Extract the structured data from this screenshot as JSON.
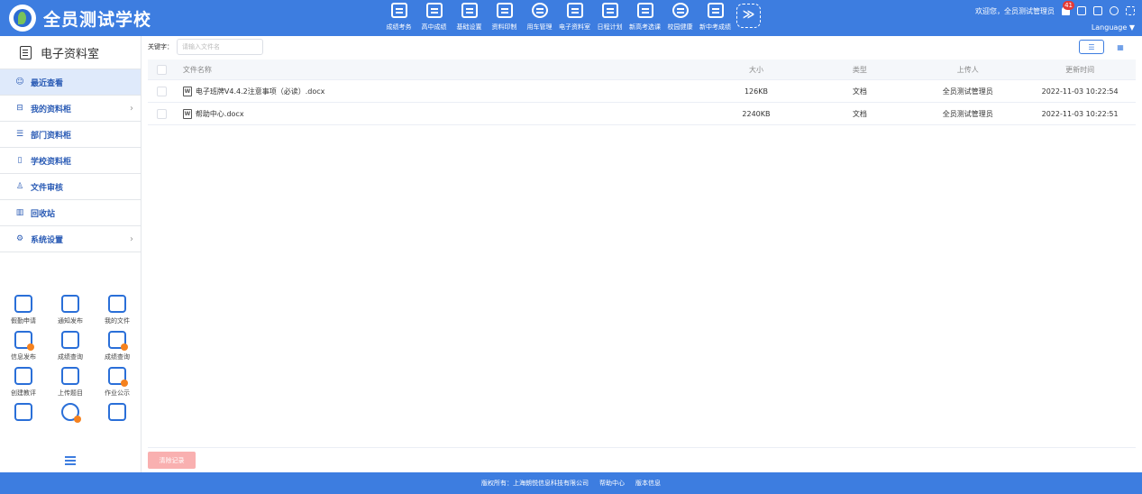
{
  "brand": {
    "name": "全员测试学校"
  },
  "topnav": [
    {
      "label": "成绩考务",
      "icon": "report-card-icon"
    },
    {
      "label": "高中成绩",
      "icon": "report-card-icon"
    },
    {
      "label": "基础设置",
      "icon": "layers-icon"
    },
    {
      "label": "资料印制",
      "icon": "printer-icon"
    },
    {
      "label": "用车管理",
      "icon": "car-icon"
    },
    {
      "label": "电子资料室",
      "icon": "document-icon"
    },
    {
      "label": "日程计划",
      "icon": "calendar-list-icon"
    },
    {
      "label": "新高考选课",
      "icon": "chair-icon"
    },
    {
      "label": "校园健康",
      "icon": "heart-pulse-icon"
    },
    {
      "label": "新中考成绩",
      "icon": "report-card-icon"
    }
  ],
  "more_icon": "double-chevron-down-icon",
  "user": {
    "welcome": "欢迎您，全员测试管理员",
    "badge_count": "41",
    "language": "Language ▼"
  },
  "sidebar": {
    "title": "电子资料室",
    "items": [
      {
        "label": "最近查看",
        "icon": "☺",
        "active": true,
        "chevron": ""
      },
      {
        "label": "我的资料柜",
        "icon": "⊟",
        "active": false,
        "chevron": "›"
      },
      {
        "label": "部门资料柜",
        "icon": "☰",
        "active": false,
        "chevron": ""
      },
      {
        "label": "学校资料柜",
        "icon": "▯",
        "active": false,
        "chevron": ""
      },
      {
        "label": "文件审核",
        "icon": "♙",
        "active": false,
        "chevron": ""
      },
      {
        "label": "回收站",
        "icon": "▥",
        "active": false,
        "chevron": ""
      },
      {
        "label": "系统设置",
        "icon": "⚙",
        "active": false,
        "chevron": "›"
      }
    ],
    "quick_links": [
      {
        "label": "假勤申请",
        "icon": "leave-request-icon"
      },
      {
        "label": "通知发布",
        "icon": "megaphone-icon"
      },
      {
        "label": "我的文件",
        "icon": "folder-icon"
      },
      {
        "label": "信息发布",
        "icon": "info-publish-icon"
      },
      {
        "label": "成绩查询",
        "icon": "score-query-icon"
      },
      {
        "label": "成绩查询",
        "icon": "score-100-icon"
      },
      {
        "label": "创建教评",
        "icon": "chat-bubble-icon"
      },
      {
        "label": "上传题目",
        "icon": "upload-question-icon"
      },
      {
        "label": "作业公示",
        "icon": "homework-icon"
      },
      {
        "label": "",
        "icon": "id-card-icon"
      },
      {
        "label": "",
        "icon": "user-settings-icon"
      },
      {
        "label": "",
        "icon": "building-icon"
      }
    ]
  },
  "search": {
    "label": "关键字：",
    "placeholder": "请输入文件名"
  },
  "view_toggle": {
    "list": "☰",
    "grid": "▦"
  },
  "table": {
    "headers": {
      "name": "文件名称",
      "size": "大小",
      "type": "类型",
      "uploader": "上传人",
      "updated": "更新时间"
    },
    "rows": [
      {
        "name": "电子班牌V4.4.2注意事项（必读）.docx",
        "size": "126KB",
        "type": "文档",
        "uploader": "全员测试管理员",
        "updated": "2022-11-03 10:22:54"
      },
      {
        "name": "帮助中心.docx",
        "size": "2240KB",
        "type": "文档",
        "uploader": "全员测试管理员",
        "updated": "2022-11-03 10:22:51"
      }
    ]
  },
  "clear_button": "清除记录",
  "footer": {
    "copyright": "版权所有：上海朗悦信息科技有限公司",
    "help": "帮助中心",
    "version": "版本信息"
  },
  "colors": {
    "primary": "#3d7de0",
    "active_bg": "#dfeafb",
    "clear_btn": "#f9b0b0"
  }
}
